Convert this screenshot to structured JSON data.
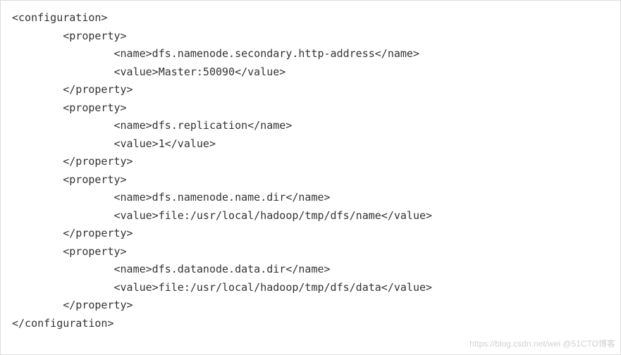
{
  "code": {
    "lines": [
      "<configuration>",
      "        <property>",
      "                <name>dfs.namenode.secondary.http-address</name>",
      "                <value>Master:50090</value>",
      "        </property>",
      "        <property>",
      "                <name>dfs.replication</name>",
      "                <value>1</value>",
      "        </property>",
      "        <property>",
      "                <name>dfs.namenode.name.dir</name>",
      "                <value>file:/usr/local/hadoop/tmp/dfs/name</value>",
      "        </property>",
      "        <property>",
      "                <name>dfs.datanode.data.dir</name>",
      "                <value>file:/usr/local/hadoop/tmp/dfs/data</value>",
      "        </property>",
      "</configuration>"
    ]
  },
  "watermark": {
    "text": "https://blog.csdn.net/wei @51CTO博客"
  }
}
